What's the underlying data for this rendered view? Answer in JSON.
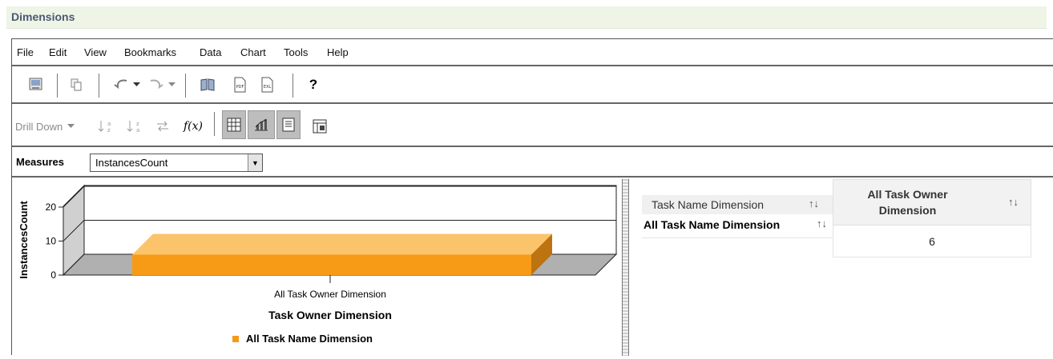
{
  "window": {
    "title": "Dimensions"
  },
  "menu": [
    "File",
    "Edit",
    "View",
    "Bookmarks",
    "Data",
    "Chart",
    "Tools",
    "Help"
  ],
  "toolbar1": {
    "icons": [
      "report-icon",
      "copy-icon",
      "undo-icon",
      "redo-icon",
      "bookmarks-icon",
      "export-pdf-icon",
      "export-excel-icon",
      "help-icon"
    ],
    "help_label": "?"
  },
  "toolbar2": {
    "drill_down_label": "Drill Down",
    "formula_label": "f(x)"
  },
  "measures": {
    "label": "Measures",
    "selected": "InstancesCount"
  },
  "chart_data": {
    "type": "bar",
    "categories": [
      "All Task Owner Dimension"
    ],
    "series": [
      {
        "name": "All Task Name Dimension",
        "values": [
          6
        ]
      }
    ],
    "xlabel": "Task Owner Dimension",
    "ylabel": "InstancesCount",
    "yticks": [
      "0",
      "10",
      "20"
    ],
    "ylim": [
      0,
      24
    ],
    "legend": "bottom",
    "colors": {
      "bar_front": "#f79a16",
      "bar_top": "#fcc46a",
      "bar_side": "#bd7310",
      "floor": "#b0b0b0"
    }
  },
  "table": {
    "row_header_top": "Task Name Dimension",
    "row_header": "All Task Name Dimension",
    "col_header": "All Task Owner Dimension",
    "cell_value": "6",
    "sort_glyph": "↑↓"
  }
}
